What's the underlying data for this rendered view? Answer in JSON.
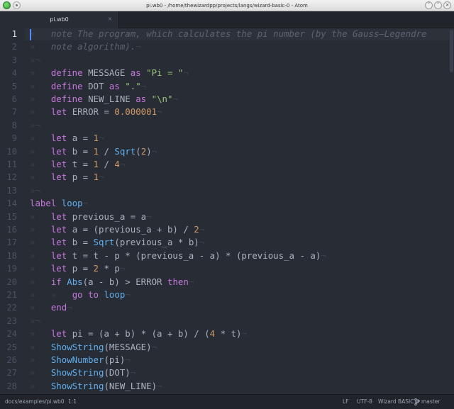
{
  "window": {
    "title": "pi.wb0 - /home/thewizardpp/projects/langs/wizard-basic-0 - Atom",
    "minimize_glyph": "˅",
    "maximize_glyph": "˄",
    "close_glyph": "×"
  },
  "tab": {
    "label": "pi.wb0",
    "close_glyph": "×"
  },
  "editor": {
    "active_line": 1,
    "line_numbers": [
      "1",
      "2",
      "3",
      "4",
      "5",
      "6",
      "7",
      "8",
      "9",
      "10",
      "11",
      "12",
      "13",
      "14",
      "15",
      "16",
      "17",
      "18",
      "19",
      "20",
      "21",
      "22",
      "23",
      "24",
      "25",
      "26",
      "27",
      "28"
    ],
    "lines": [
      [
        {
          "g": "»   "
        },
        {
          "t": "cm",
          "v": "note The program, which calculates the pi number (by the Gauss–Legendre"
        }
      ],
      [
        {
          "g": "»   "
        },
        {
          "t": "cm",
          "v": "note algorithm)."
        },
        {
          "t": "eol",
          "v": "¬"
        }
      ],
      [
        {
          "g": "»"
        },
        {
          "t": "eol",
          "v": "¬"
        }
      ],
      [
        {
          "g": "»   "
        },
        {
          "t": "kw",
          "v": "define"
        },
        {
          "v": " MESSAGE "
        },
        {
          "t": "kw",
          "v": "as"
        },
        {
          "v": " "
        },
        {
          "t": "str",
          "v": "\"Pi = \""
        },
        {
          "t": "eol",
          "v": "¬"
        }
      ],
      [
        {
          "g": "»   "
        },
        {
          "t": "kw",
          "v": "define"
        },
        {
          "v": " DOT "
        },
        {
          "t": "kw",
          "v": "as"
        },
        {
          "v": " "
        },
        {
          "t": "str",
          "v": "\".\""
        },
        {
          "t": "eol",
          "v": "¬"
        }
      ],
      [
        {
          "g": "»   "
        },
        {
          "t": "kw",
          "v": "define"
        },
        {
          "v": " NEW_LINE "
        },
        {
          "t": "kw",
          "v": "as"
        },
        {
          "v": " "
        },
        {
          "t": "str",
          "v": "\"\\n\""
        },
        {
          "t": "eol",
          "v": "¬"
        }
      ],
      [
        {
          "g": "»   "
        },
        {
          "t": "kw",
          "v": "let"
        },
        {
          "v": " ERROR = "
        },
        {
          "t": "num",
          "v": "0.000001"
        },
        {
          "t": "eol",
          "v": "¬"
        }
      ],
      [
        {
          "g": "»"
        },
        {
          "t": "eol",
          "v": "¬"
        }
      ],
      [
        {
          "g": "»   "
        },
        {
          "t": "kw",
          "v": "let"
        },
        {
          "v": " a = "
        },
        {
          "t": "num",
          "v": "1"
        },
        {
          "t": "eol",
          "v": "¬"
        }
      ],
      [
        {
          "g": "»   "
        },
        {
          "t": "kw",
          "v": "let"
        },
        {
          "v": " b = "
        },
        {
          "t": "num",
          "v": "1"
        },
        {
          "v": " / "
        },
        {
          "t": "fn",
          "v": "Sqrt"
        },
        {
          "v": "("
        },
        {
          "t": "num",
          "v": "2"
        },
        {
          "v": ")"
        },
        {
          "t": "eol",
          "v": "¬"
        }
      ],
      [
        {
          "g": "»   "
        },
        {
          "t": "kw",
          "v": "let"
        },
        {
          "v": " t = "
        },
        {
          "t": "num",
          "v": "1"
        },
        {
          "v": " / "
        },
        {
          "t": "num",
          "v": "4"
        },
        {
          "t": "eol",
          "v": "¬"
        }
      ],
      [
        {
          "g": "»   "
        },
        {
          "t": "kw",
          "v": "let"
        },
        {
          "v": " p = "
        },
        {
          "t": "num",
          "v": "1"
        },
        {
          "t": "eol",
          "v": "¬"
        }
      ],
      [
        {
          "g": "»"
        },
        {
          "t": "eol",
          "v": "¬"
        }
      ],
      [
        {
          "t": "kw",
          "v": "label"
        },
        {
          "v": " "
        },
        {
          "t": "fn",
          "v": "loop"
        },
        {
          "t": "eol",
          "v": "¬"
        }
      ],
      [
        {
          "g": "»   "
        },
        {
          "t": "kw",
          "v": "let"
        },
        {
          "v": " previous_a = a"
        },
        {
          "t": "eol",
          "v": "¬"
        }
      ],
      [
        {
          "g": "»   "
        },
        {
          "t": "kw",
          "v": "let"
        },
        {
          "v": " a = (previous_a + b) / "
        },
        {
          "t": "num",
          "v": "2"
        },
        {
          "t": "eol",
          "v": "¬"
        }
      ],
      [
        {
          "g": "»   "
        },
        {
          "t": "kw",
          "v": "let"
        },
        {
          "v": " b = "
        },
        {
          "t": "fn",
          "v": "Sqrt"
        },
        {
          "v": "(previous_a * b)"
        },
        {
          "t": "eol",
          "v": "¬"
        }
      ],
      [
        {
          "g": "»   "
        },
        {
          "t": "kw",
          "v": "let"
        },
        {
          "v": " t = t - p * (previous_a - a) * (previous_a - a)"
        },
        {
          "t": "eol",
          "v": "¬"
        }
      ],
      [
        {
          "g": "»   "
        },
        {
          "t": "kw",
          "v": "let"
        },
        {
          "v": " p = "
        },
        {
          "t": "num",
          "v": "2"
        },
        {
          "v": " * p"
        },
        {
          "t": "eol",
          "v": "¬"
        }
      ],
      [
        {
          "g": "»   "
        },
        {
          "t": "kw",
          "v": "if"
        },
        {
          "v": " "
        },
        {
          "t": "fn",
          "v": "Abs"
        },
        {
          "v": "(a - b) > ERROR "
        },
        {
          "t": "kw",
          "v": "then"
        },
        {
          "t": "eol",
          "v": "¬"
        }
      ],
      [
        {
          "g": "»   »   "
        },
        {
          "t": "kw",
          "v": "go"
        },
        {
          "v": " "
        },
        {
          "t": "kw",
          "v": "to"
        },
        {
          "v": " "
        },
        {
          "t": "fn",
          "v": "loop"
        },
        {
          "t": "eol",
          "v": "¬"
        }
      ],
      [
        {
          "g": "»   "
        },
        {
          "t": "kw",
          "v": "end"
        },
        {
          "t": "eol",
          "v": "¬"
        }
      ],
      [
        {
          "g": "»"
        },
        {
          "t": "eol",
          "v": "¬"
        }
      ],
      [
        {
          "g": "»   "
        },
        {
          "t": "kw",
          "v": "let"
        },
        {
          "v": " pi = (a + b) * (a + b) / ("
        },
        {
          "t": "num",
          "v": "4"
        },
        {
          "v": " * t)"
        },
        {
          "t": "eol",
          "v": "¬"
        }
      ],
      [
        {
          "g": "»   "
        },
        {
          "t": "fn",
          "v": "ShowString"
        },
        {
          "v": "(MESSAGE)"
        },
        {
          "t": "eol",
          "v": "¬"
        }
      ],
      [
        {
          "g": "»   "
        },
        {
          "t": "fn",
          "v": "ShowNumber"
        },
        {
          "v": "(pi)"
        },
        {
          "t": "eol",
          "v": "¬"
        }
      ],
      [
        {
          "g": "»   "
        },
        {
          "t": "fn",
          "v": "ShowString"
        },
        {
          "v": "(DOT)"
        },
        {
          "t": "eol",
          "v": "¬"
        }
      ],
      [
        {
          "g": "»   "
        },
        {
          "t": "fn",
          "v": "ShowString"
        },
        {
          "v": "(NEW_LINE)"
        },
        {
          "t": "eol",
          "v": "¬"
        }
      ]
    ]
  },
  "status": {
    "file_path": "docs/examples/pi.wb0",
    "cursor_position": "1:1",
    "line_ending": "LF",
    "encoding": "UTF-8",
    "grammar": "Wizard BASIC 0",
    "branch": "master"
  },
  "colors": {
    "keyword": "#c678dd",
    "string": "#98c379",
    "number": "#d19a66",
    "function": "#61afef",
    "comment": "#5c6370",
    "text": "#abb2bf",
    "background": "#282c34"
  }
}
